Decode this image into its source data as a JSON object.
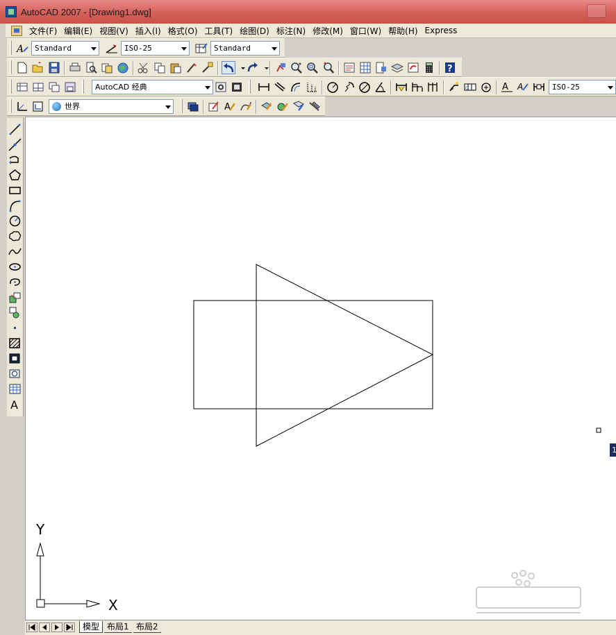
{
  "window": {
    "title": "AutoCAD 2007 - [Drawing1.dwg]"
  },
  "menu": {
    "items": [
      "文件(F)",
      "编辑(E)",
      "视图(V)",
      "插入(I)",
      "格式(O)",
      "工具(T)",
      "绘图(D)",
      "标注(N)",
      "修改(M)",
      "窗口(W)",
      "帮助(H)",
      "Express"
    ]
  },
  "styles_toolbar": {
    "text_style": "Standard",
    "dim_style": "ISO-25",
    "table_style": "Standard"
  },
  "workspace_toolbar": {
    "workspace": "AutoCAD 经典",
    "dim_style_right": "ISO-25"
  },
  "ucs_toolbar": {
    "ucs": "世界"
  },
  "left_toolbar": {
    "text_tool_label": "A"
  },
  "ucs_icon": {
    "x_label": "X",
    "y_label": "Y"
  },
  "tooltip": {
    "text": "1"
  },
  "layout_tabs": {
    "tabs": [
      "模型",
      "布局1",
      "布局2"
    ],
    "active": "模型"
  },
  "colors": {
    "titlebar": "#d4605a",
    "canvas": "#ffffff",
    "toolbar": "#ece9d8",
    "line": "#000000"
  },
  "icons": {
    "toolbar_standard": [
      "new-icon",
      "open-icon",
      "save-icon",
      "print-icon",
      "print-preview-icon",
      "publish-icon",
      "web-icon",
      "cut-icon",
      "copy-icon",
      "paste-icon",
      "match-properties-icon",
      "block-editor-icon",
      "undo-icon",
      "redo-icon",
      "pan-icon",
      "zoom-realtime-icon",
      "zoom-window-icon",
      "zoom-previous-icon",
      "properties-icon",
      "design-center-icon",
      "tool-palettes-icon",
      "sheet-set-icon",
      "markup-icon",
      "calculator-icon",
      "help-icon"
    ],
    "left_draw": [
      "line-icon",
      "construction-line-icon",
      "polyline-icon",
      "polygon-icon",
      "rectangle-icon",
      "arc-icon",
      "circle-icon",
      "revision-cloud-icon",
      "spline-icon",
      "ellipse-icon",
      "ellipse-arc-icon",
      "insert-block-icon",
      "make-block-icon",
      "point-icon",
      "hatch-icon",
      "gradient-icon",
      "region-icon",
      "table-icon",
      "multiline-text-icon"
    ]
  }
}
